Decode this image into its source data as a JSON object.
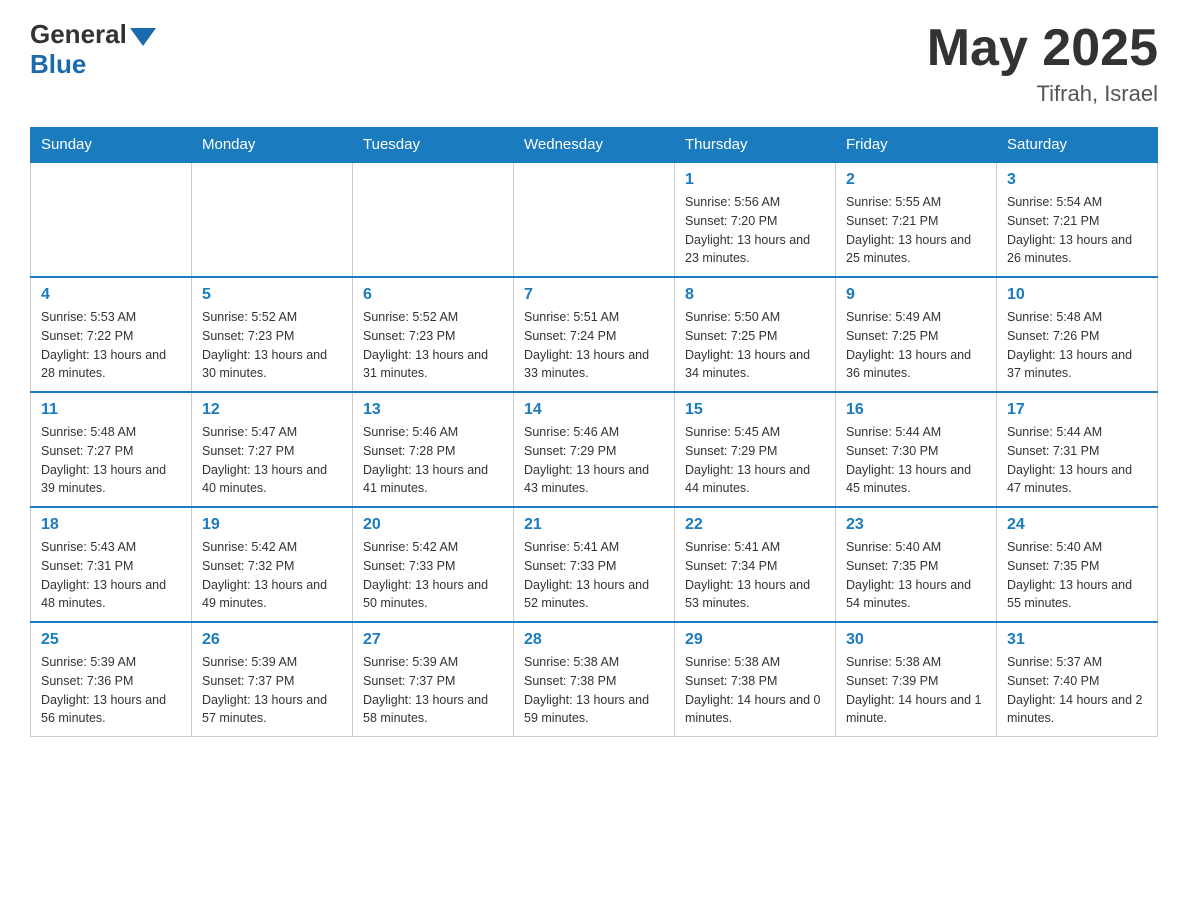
{
  "header": {
    "logo_line1": "General",
    "logo_line2": "Blue",
    "month_year": "May 2025",
    "location": "Tifrah, Israel"
  },
  "days_of_week": [
    "Sunday",
    "Monday",
    "Tuesday",
    "Wednesday",
    "Thursday",
    "Friday",
    "Saturday"
  ],
  "weeks": [
    [
      {
        "day": "",
        "info": ""
      },
      {
        "day": "",
        "info": ""
      },
      {
        "day": "",
        "info": ""
      },
      {
        "day": "",
        "info": ""
      },
      {
        "day": "1",
        "info": "Sunrise: 5:56 AM\nSunset: 7:20 PM\nDaylight: 13 hours and 23 minutes."
      },
      {
        "day": "2",
        "info": "Sunrise: 5:55 AM\nSunset: 7:21 PM\nDaylight: 13 hours and 25 minutes."
      },
      {
        "day": "3",
        "info": "Sunrise: 5:54 AM\nSunset: 7:21 PM\nDaylight: 13 hours and 26 minutes."
      }
    ],
    [
      {
        "day": "4",
        "info": "Sunrise: 5:53 AM\nSunset: 7:22 PM\nDaylight: 13 hours and 28 minutes."
      },
      {
        "day": "5",
        "info": "Sunrise: 5:52 AM\nSunset: 7:23 PM\nDaylight: 13 hours and 30 minutes."
      },
      {
        "day": "6",
        "info": "Sunrise: 5:52 AM\nSunset: 7:23 PM\nDaylight: 13 hours and 31 minutes."
      },
      {
        "day": "7",
        "info": "Sunrise: 5:51 AM\nSunset: 7:24 PM\nDaylight: 13 hours and 33 minutes."
      },
      {
        "day": "8",
        "info": "Sunrise: 5:50 AM\nSunset: 7:25 PM\nDaylight: 13 hours and 34 minutes."
      },
      {
        "day": "9",
        "info": "Sunrise: 5:49 AM\nSunset: 7:25 PM\nDaylight: 13 hours and 36 minutes."
      },
      {
        "day": "10",
        "info": "Sunrise: 5:48 AM\nSunset: 7:26 PM\nDaylight: 13 hours and 37 minutes."
      }
    ],
    [
      {
        "day": "11",
        "info": "Sunrise: 5:48 AM\nSunset: 7:27 PM\nDaylight: 13 hours and 39 minutes."
      },
      {
        "day": "12",
        "info": "Sunrise: 5:47 AM\nSunset: 7:27 PM\nDaylight: 13 hours and 40 minutes."
      },
      {
        "day": "13",
        "info": "Sunrise: 5:46 AM\nSunset: 7:28 PM\nDaylight: 13 hours and 41 minutes."
      },
      {
        "day": "14",
        "info": "Sunrise: 5:46 AM\nSunset: 7:29 PM\nDaylight: 13 hours and 43 minutes."
      },
      {
        "day": "15",
        "info": "Sunrise: 5:45 AM\nSunset: 7:29 PM\nDaylight: 13 hours and 44 minutes."
      },
      {
        "day": "16",
        "info": "Sunrise: 5:44 AM\nSunset: 7:30 PM\nDaylight: 13 hours and 45 minutes."
      },
      {
        "day": "17",
        "info": "Sunrise: 5:44 AM\nSunset: 7:31 PM\nDaylight: 13 hours and 47 minutes."
      }
    ],
    [
      {
        "day": "18",
        "info": "Sunrise: 5:43 AM\nSunset: 7:31 PM\nDaylight: 13 hours and 48 minutes."
      },
      {
        "day": "19",
        "info": "Sunrise: 5:42 AM\nSunset: 7:32 PM\nDaylight: 13 hours and 49 minutes."
      },
      {
        "day": "20",
        "info": "Sunrise: 5:42 AM\nSunset: 7:33 PM\nDaylight: 13 hours and 50 minutes."
      },
      {
        "day": "21",
        "info": "Sunrise: 5:41 AM\nSunset: 7:33 PM\nDaylight: 13 hours and 52 minutes."
      },
      {
        "day": "22",
        "info": "Sunrise: 5:41 AM\nSunset: 7:34 PM\nDaylight: 13 hours and 53 minutes."
      },
      {
        "day": "23",
        "info": "Sunrise: 5:40 AM\nSunset: 7:35 PM\nDaylight: 13 hours and 54 minutes."
      },
      {
        "day": "24",
        "info": "Sunrise: 5:40 AM\nSunset: 7:35 PM\nDaylight: 13 hours and 55 minutes."
      }
    ],
    [
      {
        "day": "25",
        "info": "Sunrise: 5:39 AM\nSunset: 7:36 PM\nDaylight: 13 hours and 56 minutes."
      },
      {
        "day": "26",
        "info": "Sunrise: 5:39 AM\nSunset: 7:37 PM\nDaylight: 13 hours and 57 minutes."
      },
      {
        "day": "27",
        "info": "Sunrise: 5:39 AM\nSunset: 7:37 PM\nDaylight: 13 hours and 58 minutes."
      },
      {
        "day": "28",
        "info": "Sunrise: 5:38 AM\nSunset: 7:38 PM\nDaylight: 13 hours and 59 minutes."
      },
      {
        "day": "29",
        "info": "Sunrise: 5:38 AM\nSunset: 7:38 PM\nDaylight: 14 hours and 0 minutes."
      },
      {
        "day": "30",
        "info": "Sunrise: 5:38 AM\nSunset: 7:39 PM\nDaylight: 14 hours and 1 minute."
      },
      {
        "day": "31",
        "info": "Sunrise: 5:37 AM\nSunset: 7:40 PM\nDaylight: 14 hours and 2 minutes."
      }
    ]
  ]
}
